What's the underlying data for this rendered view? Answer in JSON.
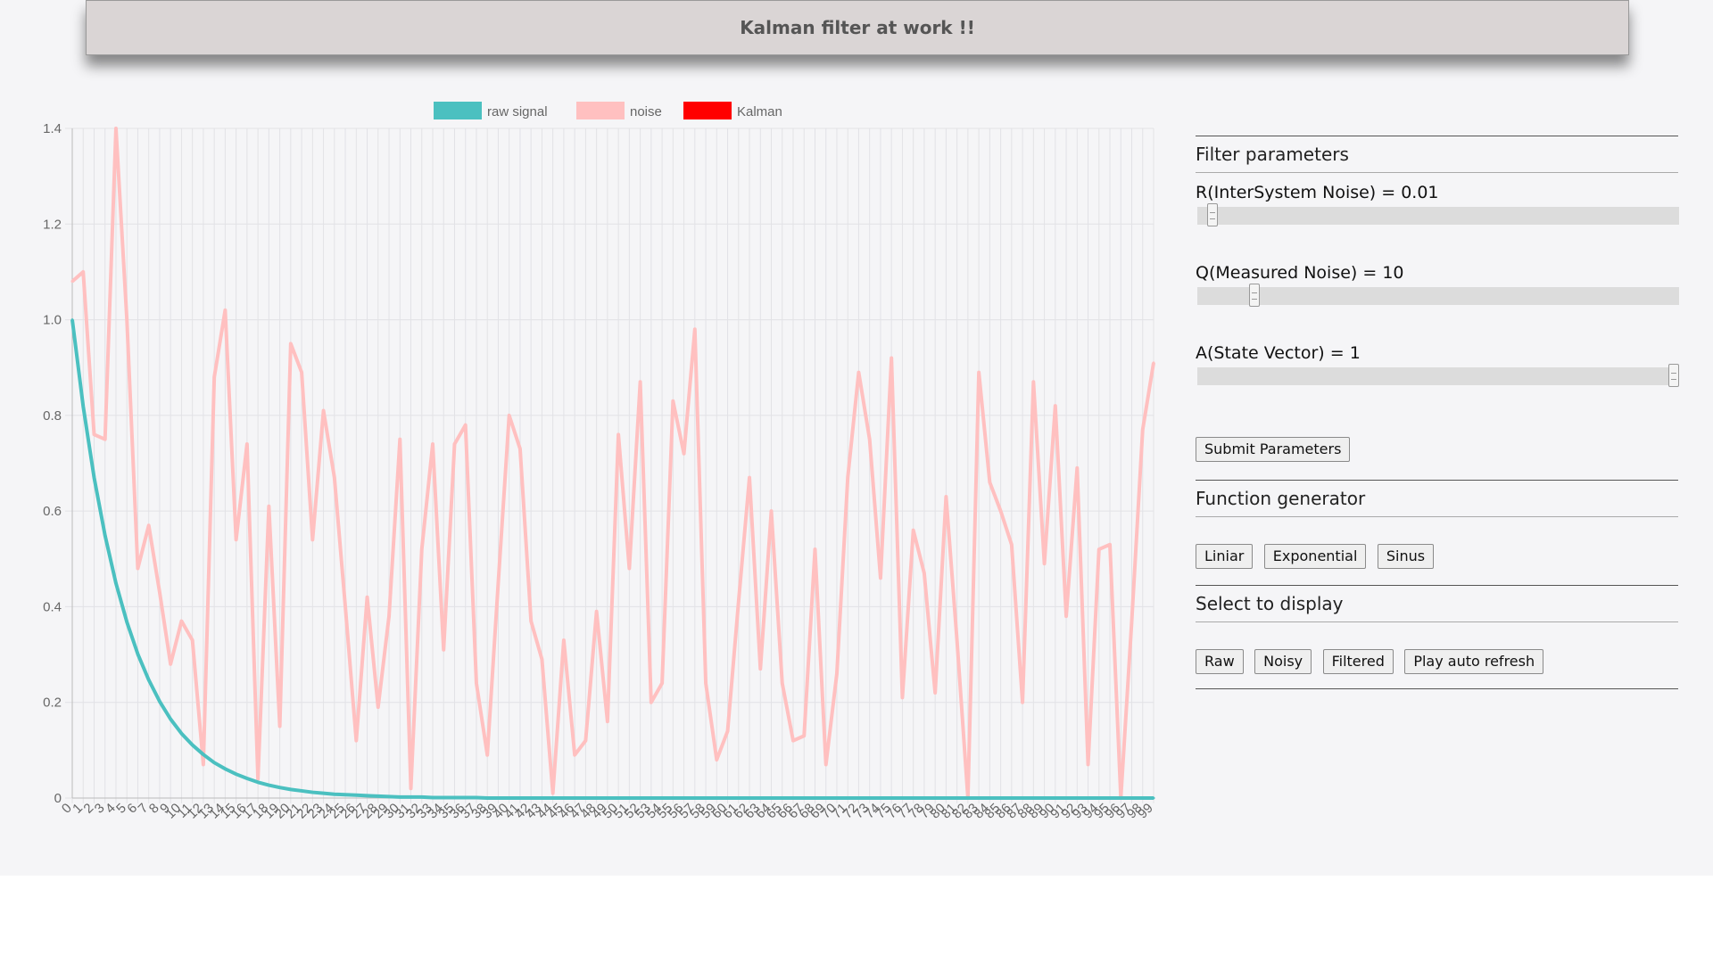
{
  "header": {
    "title": "Kalman filter at work !!"
  },
  "panel": {
    "filter_parameters_title": "Filter parameters",
    "params": [
      {
        "label": "R(InterSystem Noise) = 0.01",
        "value": 0.01,
        "slider_fraction": 0.02
      },
      {
        "label": "Q(Measured Noise) = 10",
        "value": 10,
        "slider_fraction": 0.11
      },
      {
        "label": "A(State Vector) = 1",
        "value": 1,
        "slider_fraction": 1.0
      }
    ],
    "submit_label": "Submit Parameters",
    "function_generator_title": "Function generator",
    "generator_buttons": [
      "Liniar",
      "Exponential",
      "Sinus"
    ],
    "select_display_title": "Select to display",
    "display_buttons": [
      "Raw",
      "Noisy",
      "Filtered",
      "Play auto refresh"
    ]
  },
  "colors": {
    "raw_signal": "#4bc0c0",
    "noise": "#ffc0c0",
    "kalman": "#ff0000",
    "grid": "#e2e2e6",
    "axis_text": "#666666"
  },
  "chart_data": {
    "type": "line",
    "x": [
      0,
      1,
      2,
      3,
      4,
      5,
      6,
      7,
      8,
      9,
      10,
      11,
      12,
      13,
      14,
      15,
      16,
      17,
      18,
      19,
      20,
      21,
      22,
      23,
      24,
      25,
      26,
      27,
      28,
      29,
      30,
      31,
      32,
      33,
      34,
      35,
      36,
      37,
      38,
      39,
      40,
      41,
      42,
      43,
      44,
      45,
      46,
      47,
      48,
      49,
      50,
      51,
      52,
      53,
      54,
      55,
      56,
      57,
      58,
      59,
      60,
      61,
      62,
      63,
      64,
      65,
      66,
      67,
      68,
      69,
      70,
      71,
      72,
      73,
      74,
      75,
      76,
      77,
      78,
      79,
      80,
      81,
      82,
      83,
      84,
      85,
      86,
      87,
      88,
      89,
      90,
      91,
      92,
      93,
      94,
      95,
      96,
      97,
      98,
      99
    ],
    "series": [
      {
        "name": "raw signal",
        "color": "#4bc0c0",
        "decay_rate": 0.2,
        "values": [
          1.0,
          0.819,
          0.67,
          0.549,
          0.449,
          0.368,
          0.301,
          0.247,
          0.202,
          0.165,
          0.135,
          0.111,
          0.091,
          0.074,
          0.061,
          0.05,
          0.041,
          0.033,
          0.027,
          0.022,
          0.018,
          0.015,
          0.012,
          0.01,
          0.008,
          0.007,
          0.006,
          0.005,
          0.004,
          0.003,
          0.002,
          0.002,
          0.002,
          0.001,
          0.001,
          0.001,
          0.001,
          0.001,
          0,
          0,
          0,
          0,
          0,
          0,
          0,
          0,
          0,
          0,
          0,
          0,
          0,
          0,
          0,
          0,
          0,
          0,
          0,
          0,
          0,
          0,
          0,
          0,
          0,
          0,
          0,
          0,
          0,
          0,
          0,
          0,
          0,
          0,
          0,
          0,
          0,
          0,
          0,
          0,
          0,
          0,
          0,
          0,
          0,
          0,
          0,
          0,
          0,
          0,
          0,
          0,
          0,
          0,
          0,
          0,
          0,
          0,
          0,
          0,
          0,
          0
        ]
      },
      {
        "name": "noise",
        "color": "#ffc0c0",
        "values": [
          1.08,
          1.1,
          0.76,
          0.75,
          1.4,
          1.0,
          0.48,
          0.57,
          0.43,
          0.28,
          0.37,
          0.33,
          0.07,
          0.88,
          1.02,
          0.54,
          0.74,
          0.04,
          0.61,
          0.15,
          0.95,
          0.89,
          0.54,
          0.81,
          0.67,
          0.4,
          0.12,
          0.42,
          0.19,
          0.38,
          0.75,
          0.02,
          0.52,
          0.74,
          0.31,
          0.74,
          0.78,
          0.24,
          0.09,
          0.45,
          0.8,
          0.73,
          0.37,
          0.29,
          0.01,
          0.33,
          0.09,
          0.12,
          0.39,
          0.16,
          0.76,
          0.48,
          0.87,
          0.2,
          0.24,
          0.83,
          0.72,
          0.98,
          0.24,
          0.08,
          0.14,
          0.41,
          0.67,
          0.27,
          0.6,
          0.24,
          0.12,
          0.13,
          0.52,
          0.07,
          0.26,
          0.67,
          0.89,
          0.75,
          0.46,
          0.92,
          0.21,
          0.56,
          0.47,
          0.22,
          0.63,
          0.33,
          0.0,
          0.89,
          0.66,
          0.6,
          0.53,
          0.2,
          0.87,
          0.49,
          0.82,
          0.38,
          0.69,
          0.07,
          0.52,
          0.53,
          0.0,
          0.37,
          0.77,
          0.91
        ]
      },
      {
        "name": "Kalman",
        "color": "#ff0000",
        "values": []
      }
    ],
    "ylim": [
      0,
      1.4
    ],
    "yticks": [
      "0",
      "0.2",
      "0.4",
      "0.6",
      "0.8",
      "1.0",
      "1.2",
      "1.4"
    ],
    "grid": true,
    "legend_position": "top-center"
  }
}
